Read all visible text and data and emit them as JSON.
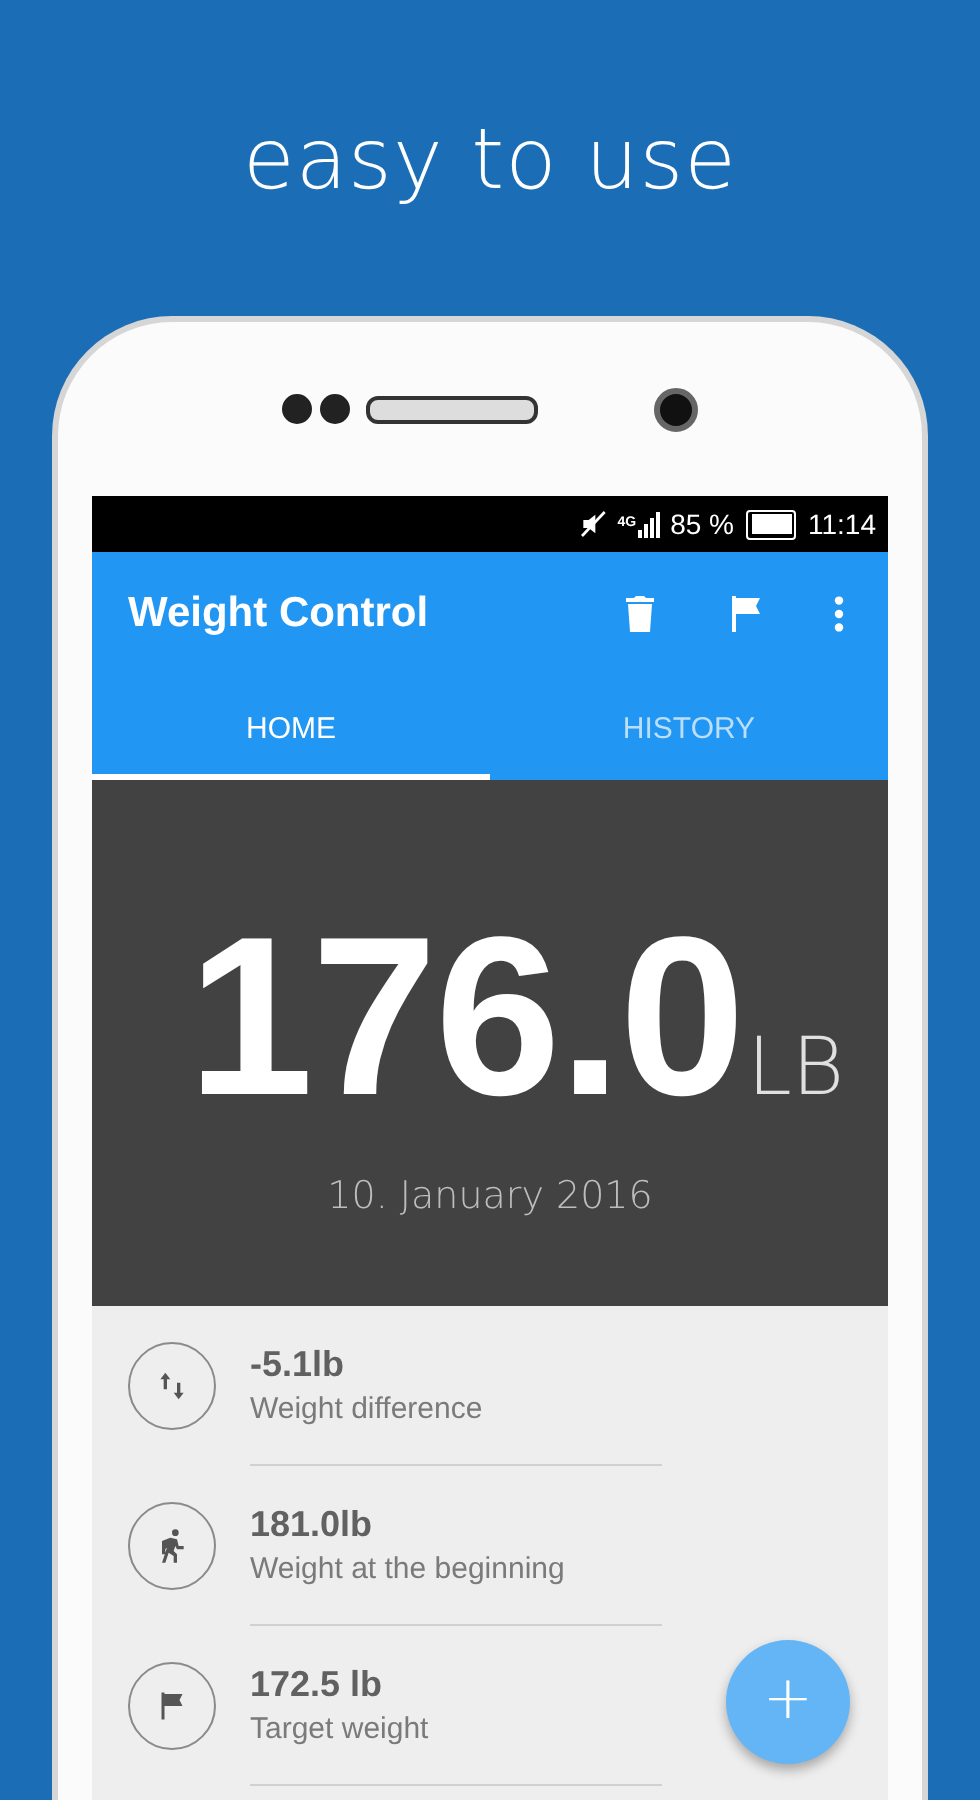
{
  "headline": "easy to use",
  "status_bar": {
    "network": "4G",
    "battery": "85 %",
    "time": "11:14"
  },
  "app_bar": {
    "title": "Weight Control"
  },
  "tabs": [
    {
      "label": "HOME",
      "selected": true
    },
    {
      "label": "HISTORY",
      "selected": false
    }
  ],
  "current": {
    "value": "176.0",
    "unit": "LB",
    "date": "10. January 2016"
  },
  "stats": [
    {
      "kind": "difference",
      "value": "-5.1lb",
      "label": "Weight difference"
    },
    {
      "kind": "start",
      "value": "181.0lb",
      "label": "Weight at the beginning"
    },
    {
      "kind": "target",
      "value": "172.5 lb",
      "label": "Target weight"
    }
  ],
  "fab": {
    "label": "+"
  }
}
